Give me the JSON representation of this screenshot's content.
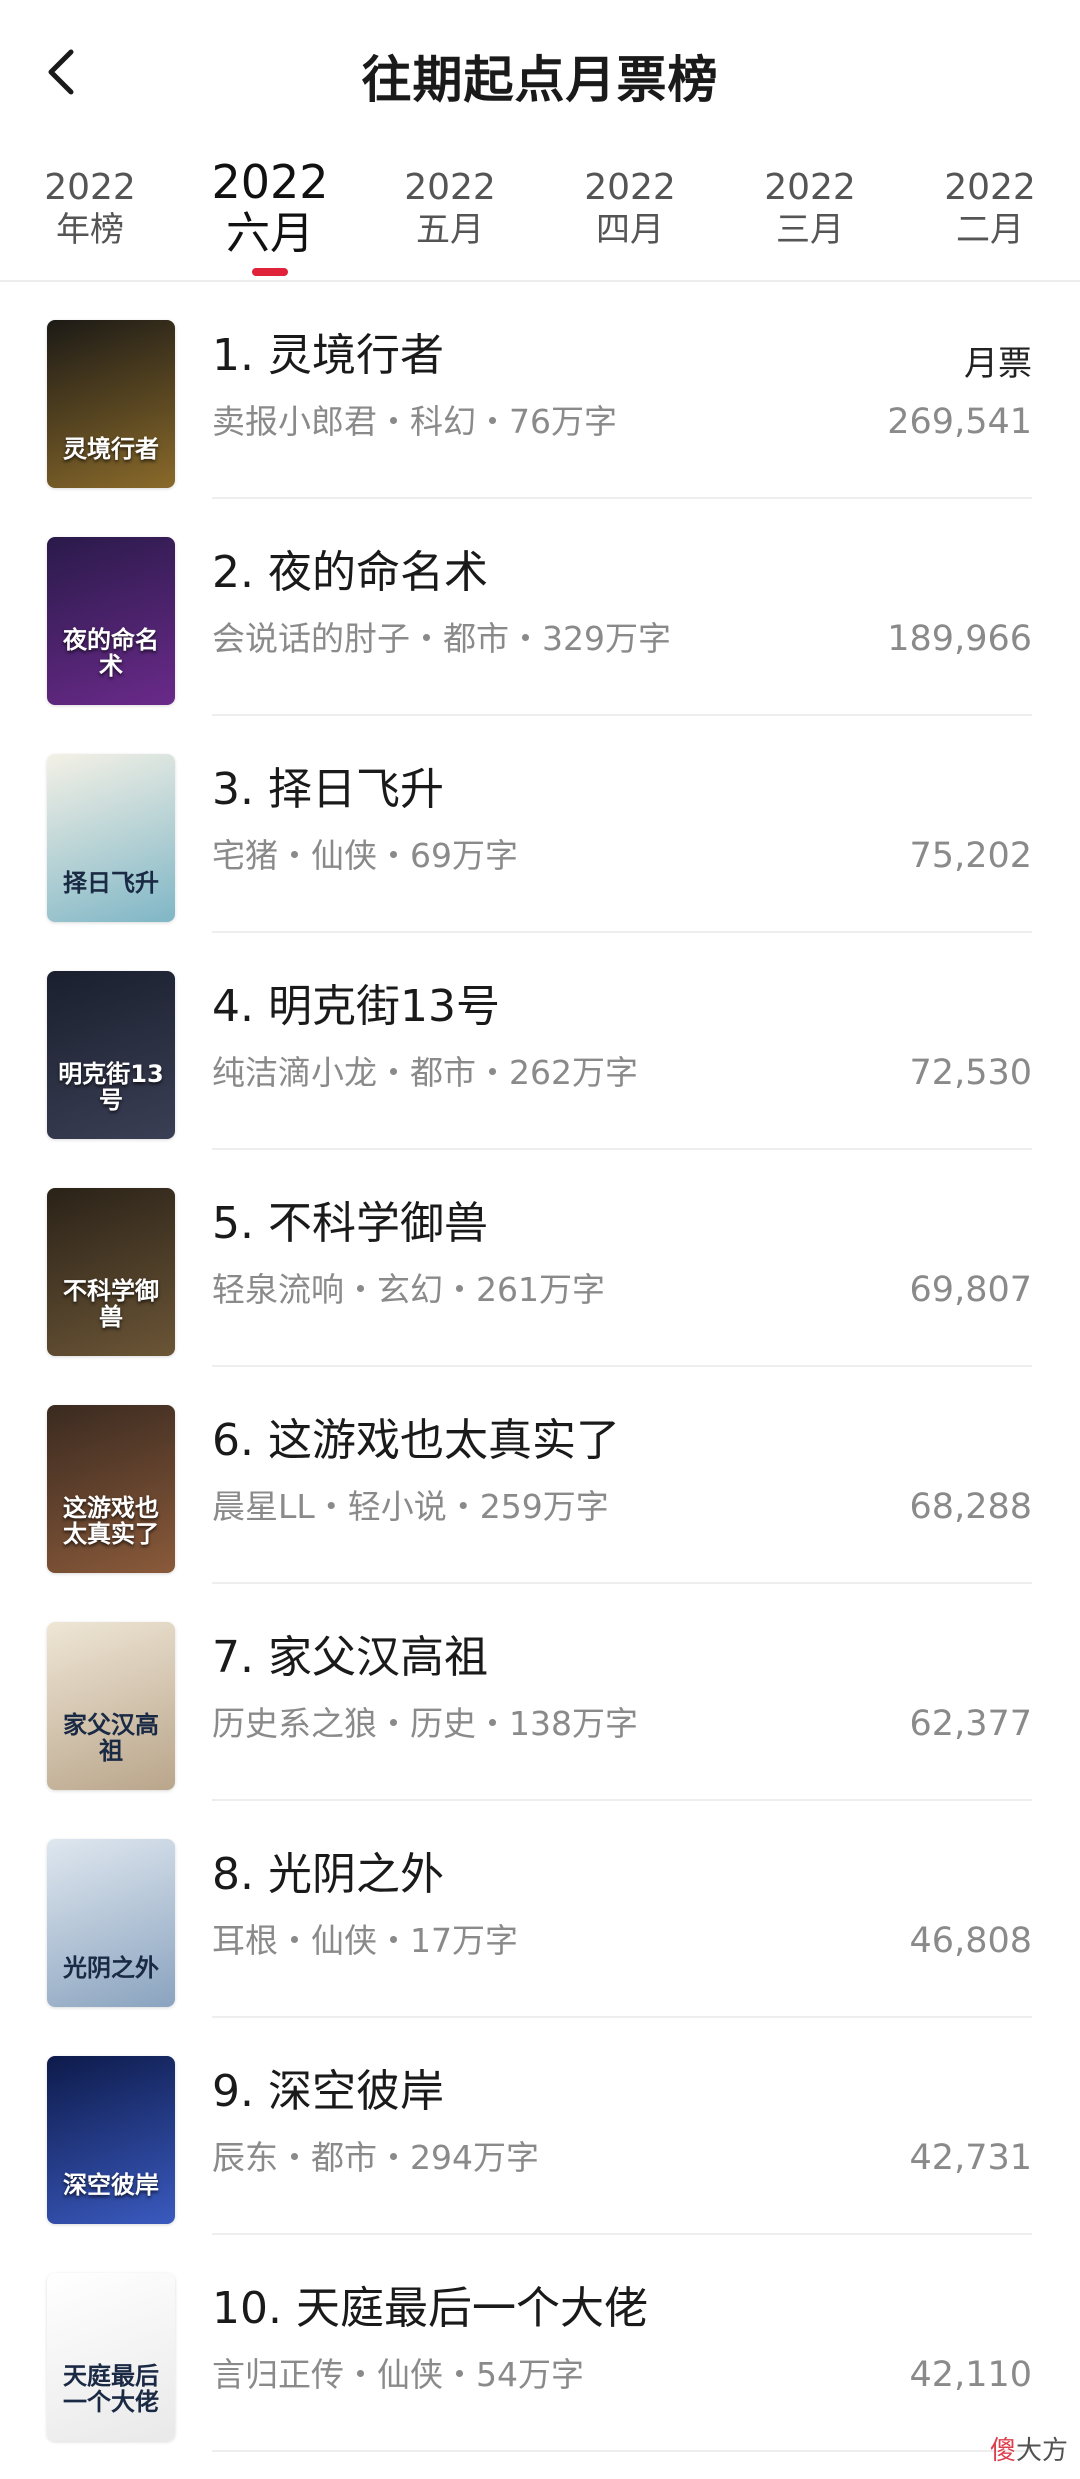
{
  "header": {
    "title": "往期起点月票榜",
    "back_icon": "chevron-left-icon"
  },
  "tabs": [
    {
      "year": "2022",
      "label": "年榜",
      "active": false
    },
    {
      "year": "2022",
      "label": "六月",
      "active": true
    },
    {
      "year": "2022",
      "label": "五月",
      "active": false
    },
    {
      "year": "2022",
      "label": "四月",
      "active": false
    },
    {
      "year": "2022",
      "label": "三月",
      "active": false
    },
    {
      "year": "2022",
      "label": "二月",
      "active": false
    }
  ],
  "accent_color": "#e0223a",
  "list": {
    "vote_label": "月票",
    "items": [
      {
        "title": "1. 灵境行者",
        "meta": "卖报小郎君・科幻・76万字",
        "votes": "269,541",
        "cover_text": "灵境行者",
        "cover_bg": [
          "#1c1a16",
          "#8a6a2a"
        ],
        "light": false
      },
      {
        "title": "2. 夜的命名术",
        "meta": "会说话的肘子・都市・329万字",
        "votes": "189,966",
        "cover_text": "夜的命名术",
        "cover_bg": [
          "#2a1a4a",
          "#6a2a8a"
        ],
        "light": false
      },
      {
        "title": "3. 择日飞升",
        "meta": "宅猪・仙侠・69万字",
        "votes": "75,202",
        "cover_text": "择日飞升",
        "cover_bg": [
          "#f4f1e6",
          "#7fb6c6"
        ],
        "light": true
      },
      {
        "title": "4. 明克街13号",
        "meta": "纯洁滴小龙・都市・262万字",
        "votes": "72,530",
        "cover_text": "明克街13号",
        "cover_bg": [
          "#1a1f2e",
          "#3b3f55"
        ],
        "light": false
      },
      {
        "title": "5. 不科学御兽",
        "meta": "轻泉流响・玄幻・261万字",
        "votes": "69,807",
        "cover_text": "不科学御兽",
        "cover_bg": [
          "#2a2218",
          "#6b5536"
        ],
        "light": false
      },
      {
        "title": "6. 这游戏也太真实了",
        "meta": "晨星LL・轻小说・259万字",
        "votes": "68,288",
        "cover_text": "这游戏也太真实了",
        "cover_bg": [
          "#3a2a20",
          "#8a5a3a"
        ],
        "light": false
      },
      {
        "title": "7. 家父汉高祖",
        "meta": "历史系之狼・历史・138万字",
        "votes": "62,377",
        "cover_text": "家父汉高祖",
        "cover_bg": [
          "#efe6d6",
          "#b9a58a"
        ],
        "light": true
      },
      {
        "title": "8. 光阴之外",
        "meta": "耳根・仙侠・17万字",
        "votes": "46,808",
        "cover_text": "光阴之外",
        "cover_bg": [
          "#dfe7ef",
          "#8aa3bf"
        ],
        "light": true
      },
      {
        "title": "9. 深空彼岸",
        "meta": "辰东・都市・294万字",
        "votes": "42,731",
        "cover_text": "深空彼岸",
        "cover_bg": [
          "#0d1a4a",
          "#3a5abf"
        ],
        "light": false
      },
      {
        "title": "10. 天庭最后一个大佬",
        "meta": "言归正传・仙侠・54万字",
        "votes": "42,110",
        "cover_text": "天庭最后一个大佬",
        "cover_bg": [
          "#ffffff",
          "#e9e9e9"
        ],
        "light": true
      }
    ]
  },
  "watermark": {
    "red": "傻",
    "rest": "大方"
  }
}
